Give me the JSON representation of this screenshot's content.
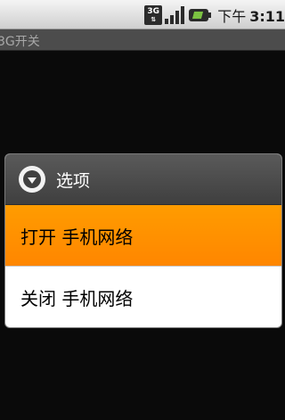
{
  "status_bar": {
    "network_type": "3G",
    "time_ampm": "下午",
    "time": "3:11"
  },
  "app": {
    "title": "3G开关"
  },
  "dialog": {
    "title": "选项",
    "options": [
      {
        "label": "打开 手机网络",
        "selected": true
      },
      {
        "label": "关闭 手机网络",
        "selected": false
      }
    ]
  },
  "colors": {
    "selected_bg": "#ff8c00",
    "dialog_header": "#4a4a4a",
    "background": "#0a0a0a"
  }
}
